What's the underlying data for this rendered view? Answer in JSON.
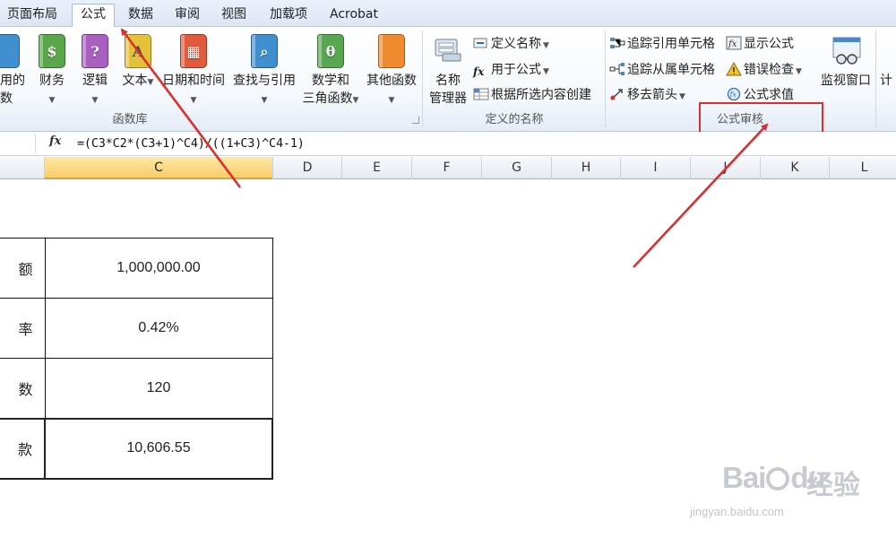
{
  "tabs": [
    {
      "label": "页面布局",
      "active": false
    },
    {
      "label": "公式",
      "active": true
    },
    {
      "label": "数据",
      "active": false
    },
    {
      "label": "审阅",
      "active": false
    },
    {
      "label": "视图",
      "active": false
    },
    {
      "label": "加载项",
      "active": false
    },
    {
      "label": "Acrobat",
      "active": false
    }
  ],
  "ribbon": {
    "function_library": {
      "group_label": "函数库",
      "buttons": [
        {
          "icon": "recently-used-book-icon",
          "line1": "使用的",
          "line2": "数"
        },
        {
          "icon": "financial-book-icon",
          "line1": "财务"
        },
        {
          "icon": "logical-book-icon",
          "line1": "逻辑",
          "glyph": "?"
        },
        {
          "icon": "text-book-icon",
          "line1": "文本",
          "glyph": "A"
        },
        {
          "icon": "date-time-book-icon",
          "line1": "日期和时间"
        },
        {
          "icon": "lookup-reference-book-icon",
          "line1": "查找与引用"
        },
        {
          "icon": "math-trig-book-icon",
          "line1": "数学和",
          "line2": "三角函数",
          "glyph": "θ"
        },
        {
          "icon": "more-functions-book-icon",
          "line1": "其他函数"
        }
      ]
    },
    "defined_names": {
      "group_label": "定义的名称",
      "name_manager_line1": "名称",
      "name_manager_line2": "管理器",
      "define_name": "定义名称",
      "use_in_formula": "用于公式",
      "create_from_selection": "根据所选内容创建"
    },
    "formula_auditing": {
      "group_label": "公式审核",
      "trace_precedents": "追踪引用单元格",
      "trace_dependents": "追踪从属单元格",
      "remove_arrows": "移去箭头",
      "show_formulas": "显示公式",
      "error_checking": "错误检查",
      "evaluate_formula": "公式求值",
      "watch_window": "监视窗口"
    },
    "calculation_partial": "计"
  },
  "formula_bar": {
    "fx_label": "fx",
    "formula": "=(C3*C2*(C3+1)^C4)/((1+C3)^C4-1)"
  },
  "columns": [
    {
      "label": "",
      "selected": false
    },
    {
      "label": "C",
      "selected": true
    },
    {
      "label": "D",
      "selected": false
    },
    {
      "label": "E",
      "selected": false
    },
    {
      "label": "F",
      "selected": false
    },
    {
      "label": "G",
      "selected": false
    },
    {
      "label": "H",
      "selected": false
    },
    {
      "label": "I",
      "selected": false
    },
    {
      "label": "J",
      "selected": false
    },
    {
      "label": "K",
      "selected": false
    },
    {
      "label": "L",
      "selected": false
    }
  ],
  "table": [
    {
      "label": "额",
      "value": "1,000,000.00"
    },
    {
      "label": "率",
      "value": "0.42%"
    },
    {
      "label": "数",
      "value": "120"
    },
    {
      "label": "款",
      "value": "10,606.55"
    }
  ],
  "watermark": {
    "brand": "Bai",
    "brand_tail": "du",
    "brand_cn": "经验",
    "url": "jingyan.baidu.com"
  },
  "colors": {
    "annotation_red": "#d9302f",
    "selected_column": "#f8cc6a"
  }
}
